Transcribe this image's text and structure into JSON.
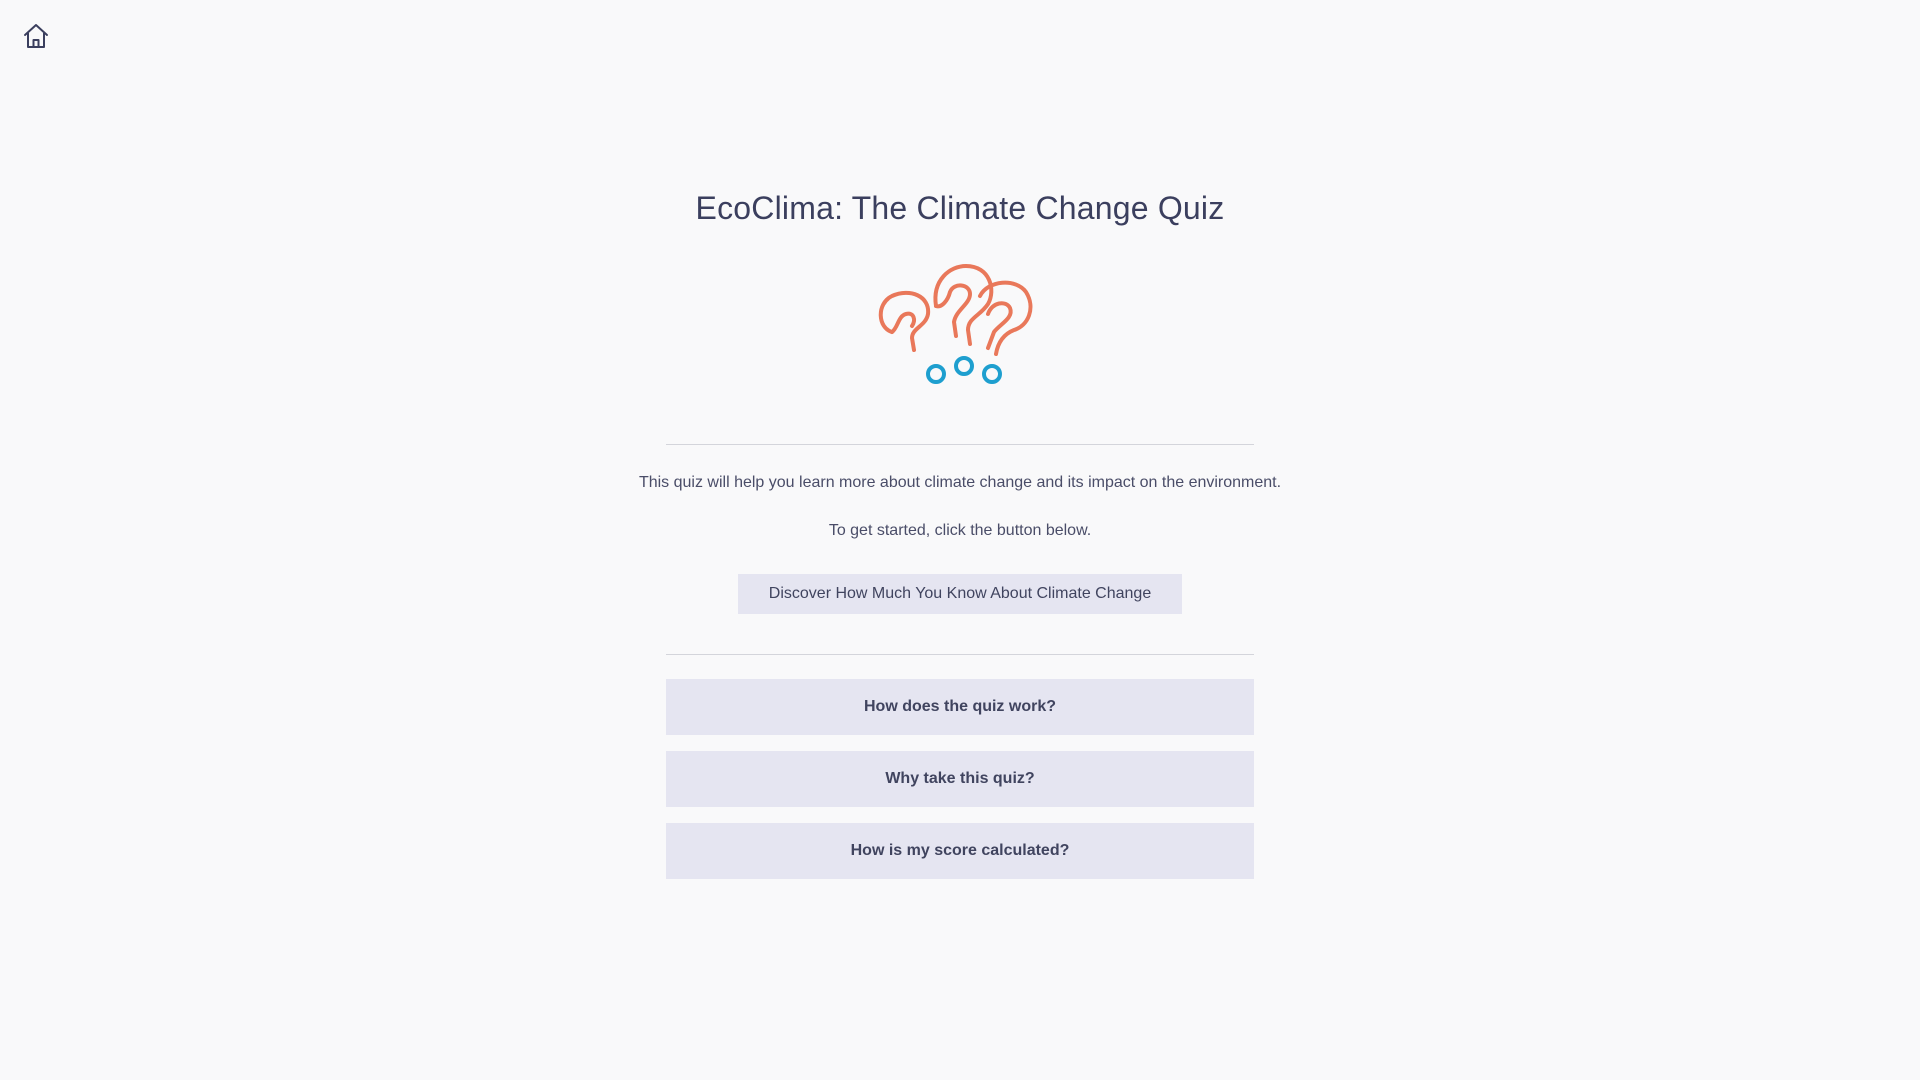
{
  "nav": {
    "home_icon": "home-icon"
  },
  "page": {
    "title": "EcoClima: The Climate Change Quiz",
    "logo_icon": "question-marks-icon",
    "intro": "This quiz will help you learn more about climate change and its impact on the environment.",
    "instruction": "To get started, click the button below.",
    "start_button": "Discover How Much You Know About Climate Change"
  },
  "faq": [
    {
      "label": "How does the quiz work?"
    },
    {
      "label": "Why take this quiz?"
    },
    {
      "label": "How is my score calculated?"
    }
  ],
  "colors": {
    "background": "#f9f9fa",
    "text": "#3e4262",
    "button_bg": "#e5e5f1",
    "logo_orange": "#e9785a",
    "logo_blue": "#1e9fcf"
  }
}
